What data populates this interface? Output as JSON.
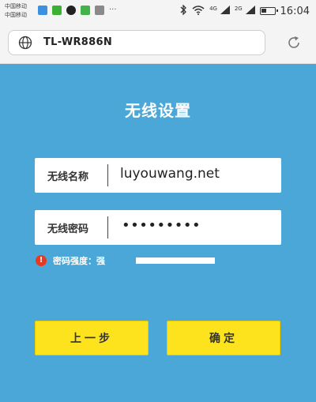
{
  "status_bar": {
    "carrier_line1": "中国移动",
    "carrier_line2": "中国移动",
    "time": "16:04",
    "signal_labels": [
      "4G",
      "2G"
    ],
    "icons": [
      "bluetooth-icon",
      "wifi-icon",
      "signal-icon",
      "battery-icon"
    ]
  },
  "browser": {
    "url": "TL-WR886N",
    "icons": [
      "globe-icon",
      "reload-icon"
    ]
  },
  "form": {
    "title": "无线设置",
    "ssid_label": "无线名称",
    "ssid_value": "luyouwang.net",
    "password_label": "无线密码",
    "password_value": "•••••••••",
    "strength_label": "密码强度：强",
    "strength_level": 1.0,
    "prev_button": "上一步",
    "confirm_button": "确定"
  },
  "colors": {
    "background": "#4aa7d8",
    "button": "#fce31e",
    "warning": "#e83a23"
  }
}
